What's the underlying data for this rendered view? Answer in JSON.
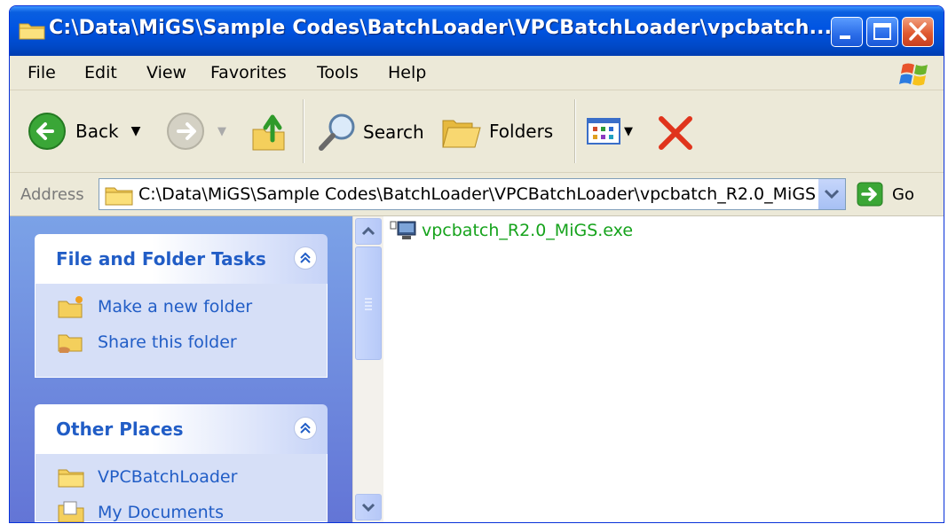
{
  "window": {
    "title": "C:\\Data\\MiGS\\Sample Codes\\BatchLoader\\VPCBatchLoader\\vpcbatch..."
  },
  "menu": [
    "File",
    "Edit",
    "View",
    "Favorites",
    "Tools",
    "Help"
  ],
  "toolbar": {
    "back_label": "Back",
    "search_label": "Search",
    "folders_label": "Folders"
  },
  "address": {
    "label": "Address",
    "value": "C:\\Data\\MiGS\\Sample Codes\\BatchLoader\\VPCBatchLoader\\vpcbatch_R2.0_MiGS",
    "go_label": "Go"
  },
  "file_tasks": {
    "title": "File and Folder Tasks",
    "items": [
      "Make a new folder",
      "Share this folder"
    ]
  },
  "other_places": {
    "title": "Other Places",
    "items": [
      "VPCBatchLoader",
      "My Documents"
    ]
  },
  "files": [
    {
      "name": "vpcbatch_R2.0_MiGS.exe"
    }
  ],
  "colors": {
    "title_blue": "#0054e3",
    "task_link": "#215dc6",
    "file_green": "#16a31c",
    "pane_blue": "#6f8ee0"
  },
  "icons": {
    "title": "folder-icon",
    "back": "back-arrow-icon",
    "forward": "forward-arrow-icon",
    "up": "folder-up-icon",
    "search": "magnifier-icon",
    "folders": "folders-icon",
    "views": "views-icon",
    "delete": "delete-x-icon",
    "go": "go-arrow-icon",
    "new_folder": "new-folder-icon",
    "share": "share-folder-icon",
    "folder": "folder-icon",
    "documents": "my-documents-icon",
    "exe": "exe-file-icon"
  }
}
